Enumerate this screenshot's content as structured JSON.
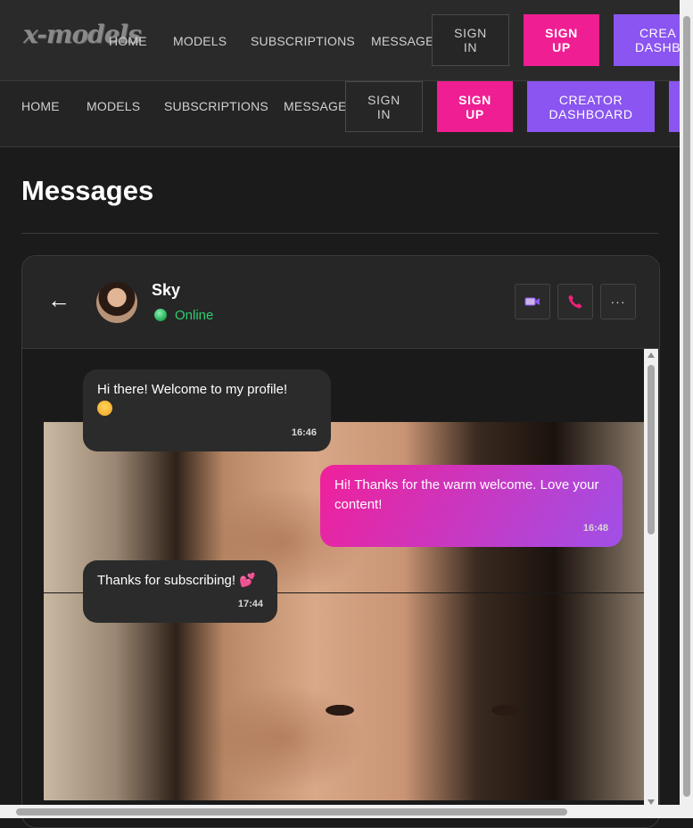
{
  "header": {
    "logo": "x-models",
    "nav": [
      "HOME",
      "MODELS",
      "SUBSCRIPTIONS",
      "MESSAGES"
    ],
    "sign_in": "SIGN\nIN",
    "sign_up": "SIGN\nUP",
    "creator_dashboard_partial": "CREA\nDASHB"
  },
  "nav2": {
    "links": [
      "HOME",
      "MODELS",
      "SUBSCRIPTIONS",
      "MESSAGES"
    ],
    "sign_in": "SIGN\nIN",
    "sign_up": "SIGN\nUP",
    "creator_dashboard": "CREATOR\nDASHBOARD"
  },
  "page": {
    "title": "Messages"
  },
  "chat": {
    "back_glyph": "←",
    "contact": {
      "name": "Sky",
      "status": "Online",
      "status_color": "#2ecc71"
    },
    "actions": {
      "video_icon": "video-camera-icon",
      "phone_icon": "phone-icon",
      "more_glyph": "···"
    },
    "messages": [
      {
        "direction": "in",
        "text": "Hi there! Welcome to my profile!",
        "emoji": "smiling-face-icon",
        "time": "16:46"
      },
      {
        "direction": "out",
        "text": "Hi! Thanks for the warm welcome. Love your content!",
        "time": "16:48"
      },
      {
        "direction": "in",
        "text": "Thanks for subscribing!",
        "emoji": "two-hearts-icon",
        "time": "17:44"
      }
    ]
  },
  "colors": {
    "accent_pink": "#f01e93",
    "accent_purple": "#8a55f0",
    "background": "#1b1b1b",
    "panel": "#262626"
  }
}
